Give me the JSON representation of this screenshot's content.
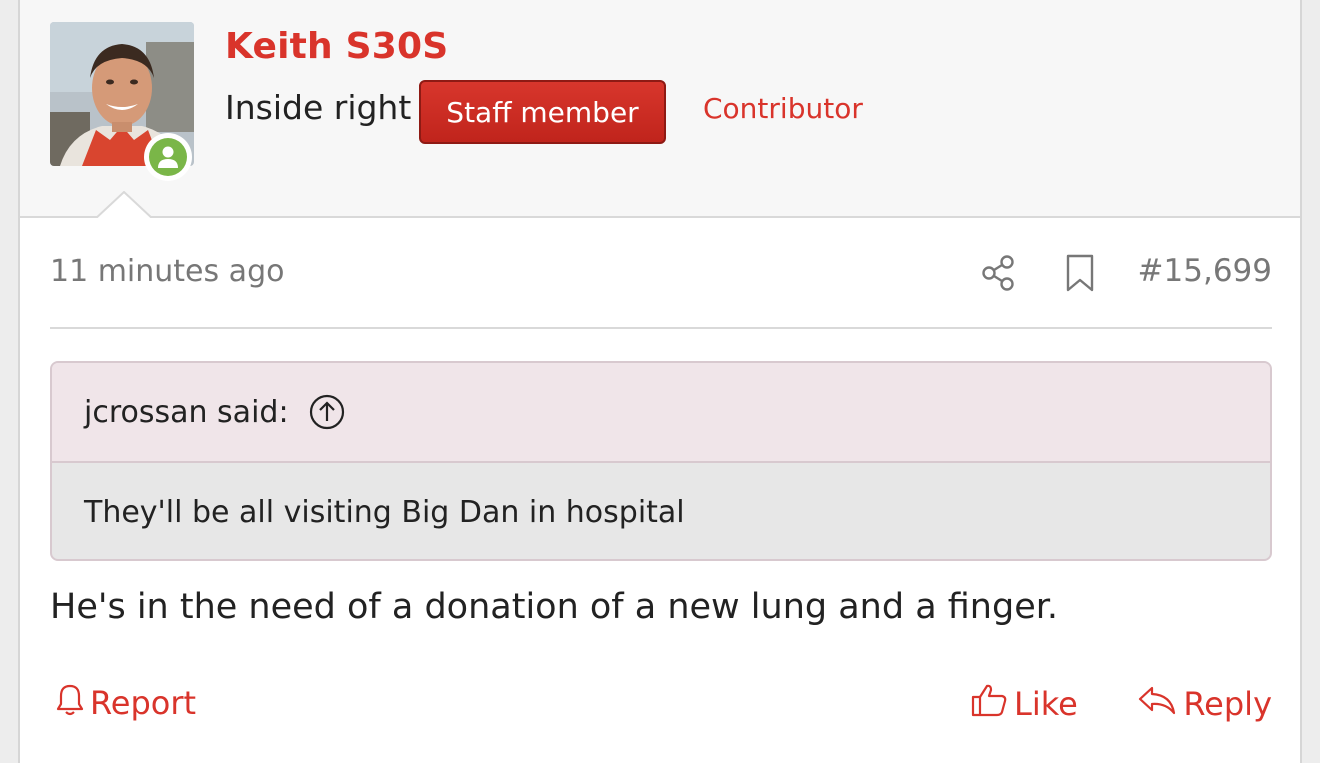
{
  "post": {
    "author": {
      "username": "Keith S30S",
      "user_title": "Inside right",
      "staff_badge": "Staff member",
      "banner": "Contributor",
      "online": true
    },
    "timestamp": "11 minutes ago",
    "post_number": "#15,699",
    "quote": {
      "attribution": "jcrossan said:",
      "text": "They'll be all visiting Big Dan in hospital"
    },
    "body": "He's in the need of a donation of a new lung and a finger.",
    "actions": {
      "report": "Report",
      "like": "Like",
      "reply": "Reply"
    }
  },
  "colors": {
    "accent": "#d9342b",
    "online": "#7ab648",
    "quote_header_bg": "#f0e5e9",
    "quote_body_bg": "#e7e7e7"
  },
  "icons": [
    "user-online-icon",
    "share-icon",
    "bookmark-icon",
    "arrow-up-circle-icon",
    "bell-icon",
    "thumbs-up-icon",
    "reply-arrow-icon"
  ]
}
